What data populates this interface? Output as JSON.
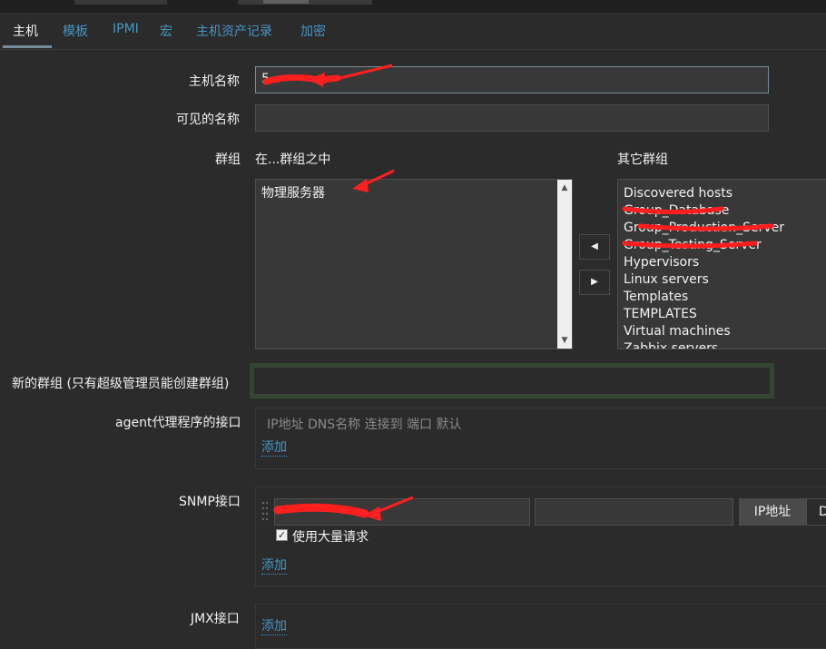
{
  "tabs": [
    {
      "label": "主机",
      "active": true
    },
    {
      "label": "模板"
    },
    {
      "label": "IPMI"
    },
    {
      "label": "宏"
    },
    {
      "label": "主机资产记录"
    },
    {
      "label": "加密"
    }
  ],
  "form": {
    "host_name_label": "主机名称",
    "host_name_value": "5",
    "visible_name_label": "可见的名称",
    "visible_name_value": "",
    "groups_label": "群组",
    "in_groups_label": "在...群组之中",
    "other_groups_label": "其它群组",
    "in_groups": [
      "物理服务器"
    ],
    "other_groups": [
      "Discovered hosts",
      "Group_Database",
      "Group_Production_Server",
      "Group_Testing_Server",
      "Hypervisors",
      "Linux servers",
      "Templates",
      "TEMPLATES",
      "Virtual machines",
      "Zabbix servers"
    ],
    "move_left": "◀",
    "move_right": "▶",
    "new_group_label": "新的群组 (只有超级管理员能创建群组)",
    "new_group_value": "",
    "agent_label": "agent代理程序的接口",
    "interface_headers": "IP地址  DNS名称  连接到  端口  默认",
    "add_link": "添加",
    "snmp_label": "SNMP接口",
    "snmp_ip_value": "",
    "snmp_dns_value": "",
    "snmp_ip_button": "IP地址",
    "snmp_dns_button": "D",
    "bulk_label": "使用大量请求",
    "bulk_checked": true,
    "jmx_label": "JMX接口"
  },
  "colors": {
    "background": "#2b2b2b",
    "link": "#4796c4",
    "annotation_red": "#ff1f1f"
  }
}
